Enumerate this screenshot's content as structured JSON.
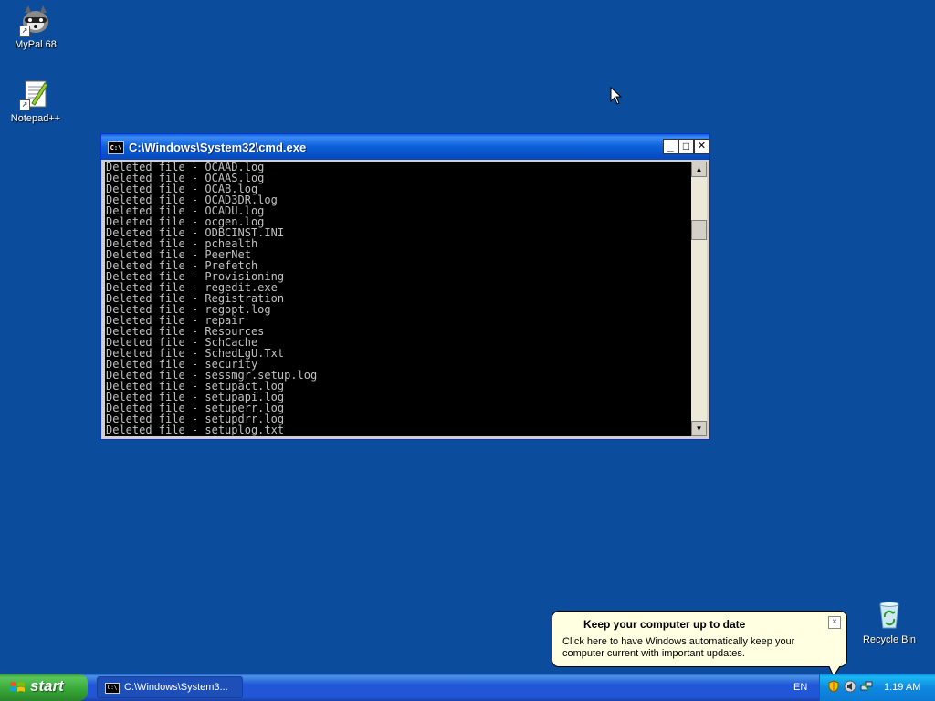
{
  "desktop": {
    "icons": [
      {
        "label": "MyPal 68",
        "icon": "raccoon-icon"
      },
      {
        "label": "Notepad++",
        "icon": "notepad-plus-plus-icon"
      },
      {
        "label": "Recycle Bin",
        "icon": "recycle-bin-icon"
      }
    ]
  },
  "cmd_window": {
    "title": "C:\\Windows\\System32\\cmd.exe",
    "icon_label": "C:\\",
    "buttons": {
      "minimize": "_",
      "maximize": "□",
      "close": "✕"
    },
    "lines": [
      "Deleted file - OCAAD.log",
      "Deleted file - OCAAS.log",
      "Deleted file - OCAB.log",
      "Deleted file - OCAD3DR.log",
      "Deleted file - OCADU.log",
      "Deleted file - ocgen.log",
      "Deleted file - ODBCINST.INI",
      "Deleted file - pchealth",
      "Deleted file - PeerNet",
      "Deleted file - Prefetch",
      "Deleted file - Provisioning",
      "Deleted file - regedit.exe",
      "Deleted file - Registration",
      "Deleted file - regopt.log",
      "Deleted file - repair",
      "Deleted file - Resources",
      "Deleted file - SchCache",
      "Deleted file - SchedLgU.Txt",
      "Deleted file - security",
      "Deleted file - sessmgr.setup.log",
      "Deleted file - setupact.log",
      "Deleted file - setupapi.log",
      "Deleted file - setuperr.log",
      "Deleted file - setupdrr.log",
      "Deleted file - setuplog.txt"
    ],
    "text_color": "#c0c0c0",
    "background_color": "#000000"
  },
  "balloon": {
    "title": "Keep your computer up to date",
    "text": "Click here to have Windows automatically keep your computer current with important updates.",
    "close": "×"
  },
  "taskbar": {
    "start_label": "start",
    "tasks": [
      {
        "label": "C:\\Windows\\System3...",
        "icon": "cmd-icon"
      }
    ],
    "language": "EN",
    "clock": "1:19 AM",
    "tray_icons": [
      "security-shield-icon",
      "speaker-icon",
      "network-icon"
    ]
  },
  "colors": {
    "desktop_background": "#0b4d9c",
    "taskbar_blue": "#2157d7",
    "start_green": "#36a636",
    "balloon_yellow": "#ffffe1"
  }
}
